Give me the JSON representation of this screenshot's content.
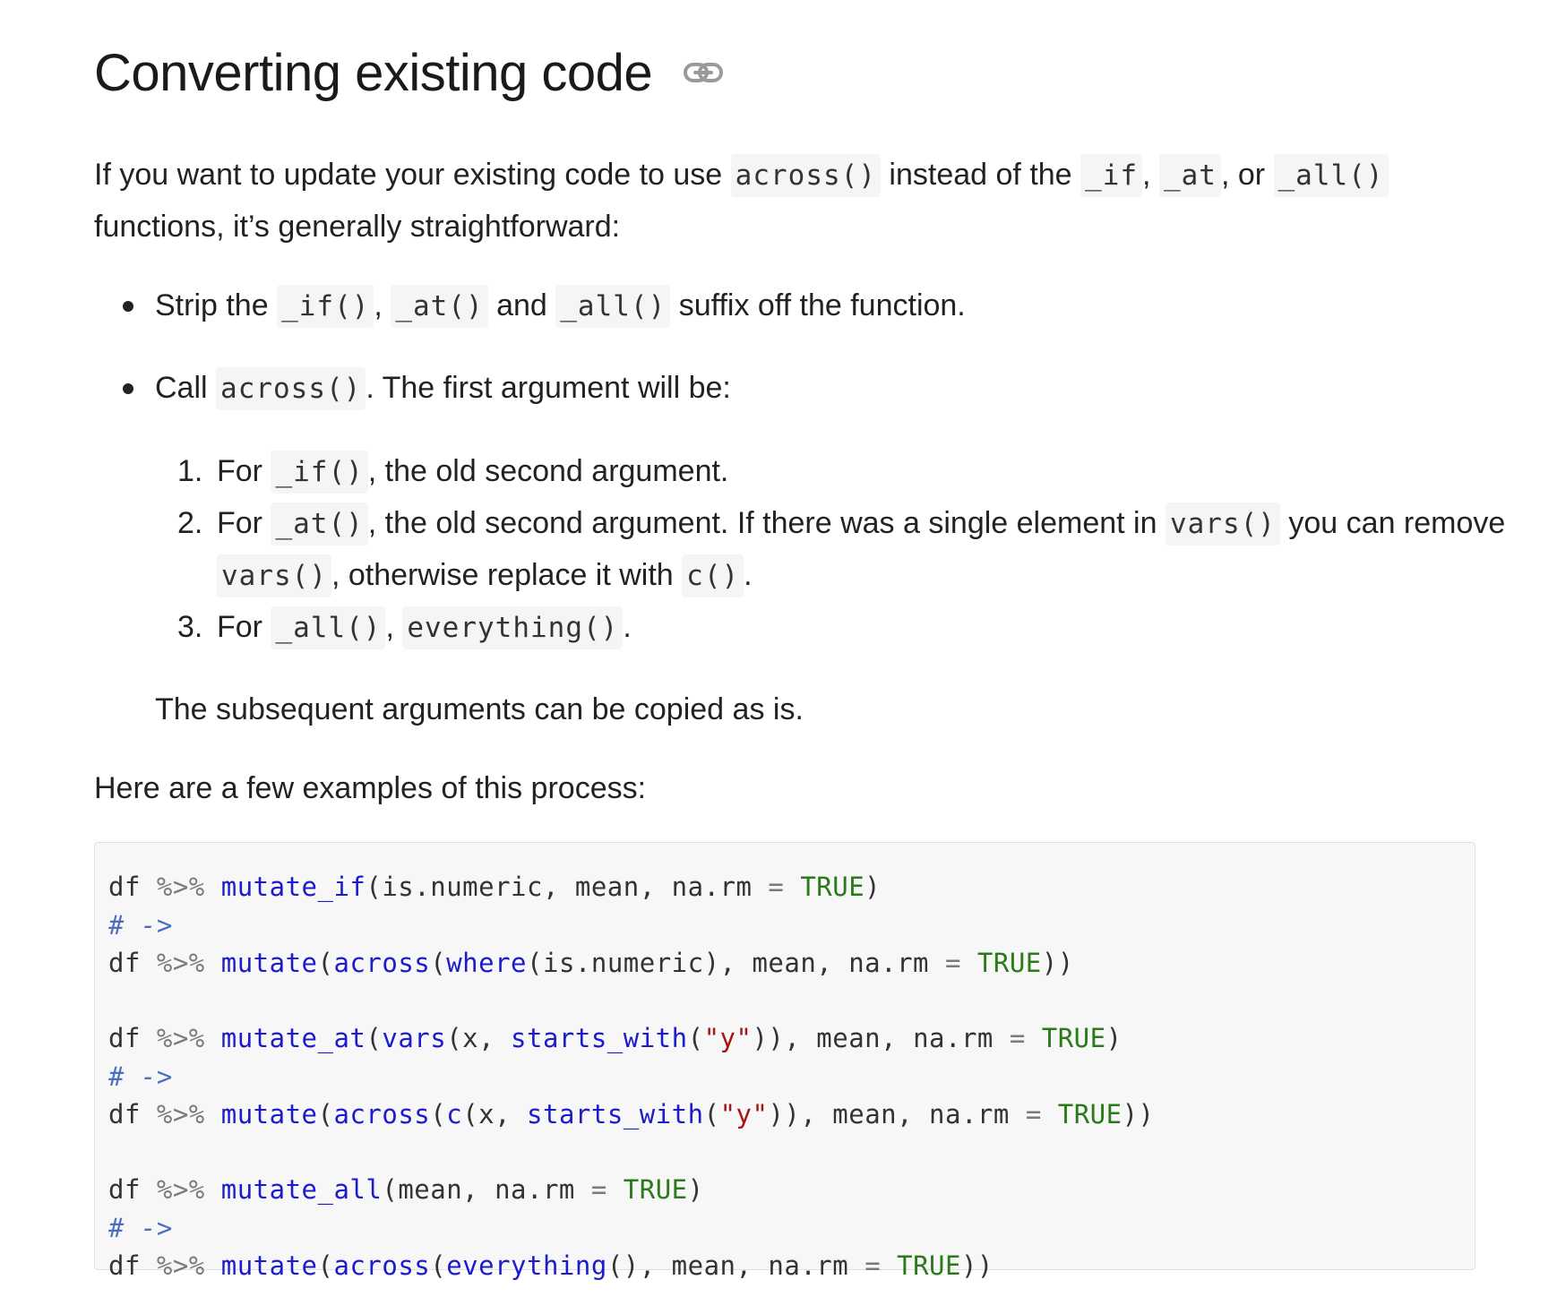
{
  "heading": "Converting existing code",
  "icons": {
    "anchor": "link-icon"
  },
  "intro": {
    "t1": "If you want to update your existing code to use ",
    "c1": "across()",
    "t2": " instead of the ",
    "c2": "_if",
    "t3": ", ",
    "c3": "_at",
    "t4": ", or ",
    "c4": "_all()",
    "line2": "functions, it’s generally straightforward:"
  },
  "bullet1": {
    "t1": "Strip the ",
    "c1": "_if()",
    "t2": ", ",
    "c2": "_at()",
    "t3": " and ",
    "c3": "_all()",
    "t4": " suffix off the function."
  },
  "bullet2": {
    "t1": "Call ",
    "c1": "across()",
    "t2": ". The first argument will be:"
  },
  "ordered": [
    {
      "num": "1.",
      "t1": "For ",
      "c1": "_if()",
      "t2": ", the old second argument."
    },
    {
      "num": "2.",
      "t1": "For ",
      "c1": "_at()",
      "t2": ", the old second argument. If there was a single element in ",
      "c2": "vars()",
      "t3": " you can remove",
      "l2c1": "vars()",
      "l2t1": ", otherwise replace it with ",
      "l2c2": "c()",
      "l2t2": "."
    },
    {
      "num": "3.",
      "t1": "For ",
      "c1": "_all()",
      "t2": ", ",
      "c2": "everything()",
      "t3": "."
    }
  ],
  "subsequent": "The subsequent arguments can be copied as is.",
  "examples_intro": "Here are a few examples of this process:",
  "code": {
    "ex1": {
      "l1": [
        "df ",
        "%>%",
        " ",
        "mutate_if",
        "(is.numeric, mean, na.rm ",
        "=",
        " ",
        "TRUE",
        ")"
      ],
      "comment": "# ->",
      "l3": [
        "df ",
        "%>%",
        " ",
        "mutate",
        "(",
        "across",
        "(",
        "where",
        "(is.numeric), mean, na.rm ",
        "=",
        " ",
        "TRUE",
        "))"
      ]
    },
    "ex2": {
      "l1": [
        "df ",
        "%>%",
        " ",
        "mutate_at",
        "(",
        "vars",
        "(x, ",
        "starts_with",
        "(",
        "\"y\"",
        ")), mean, na.rm ",
        "=",
        " ",
        "TRUE",
        ")"
      ],
      "comment": "# ->",
      "l3": [
        "df ",
        "%>%",
        " ",
        "mutate",
        "(",
        "across",
        "(",
        "c",
        "(x, ",
        "starts_with",
        "(",
        "\"y\"",
        ")), mean, na.rm ",
        "=",
        " ",
        "TRUE",
        "))"
      ]
    },
    "ex3": {
      "l1": [
        "df ",
        "%>%",
        " ",
        "mutate_all",
        "(mean, na.rm ",
        "=",
        " ",
        "TRUE",
        ")"
      ],
      "comment": "# ->",
      "l3": [
        "df ",
        "%>%",
        " ",
        "mutate",
        "(",
        "across",
        "(",
        "everything",
        "(), mean, na.rm ",
        "=",
        " ",
        "TRUE",
        "))"
      ]
    }
  }
}
